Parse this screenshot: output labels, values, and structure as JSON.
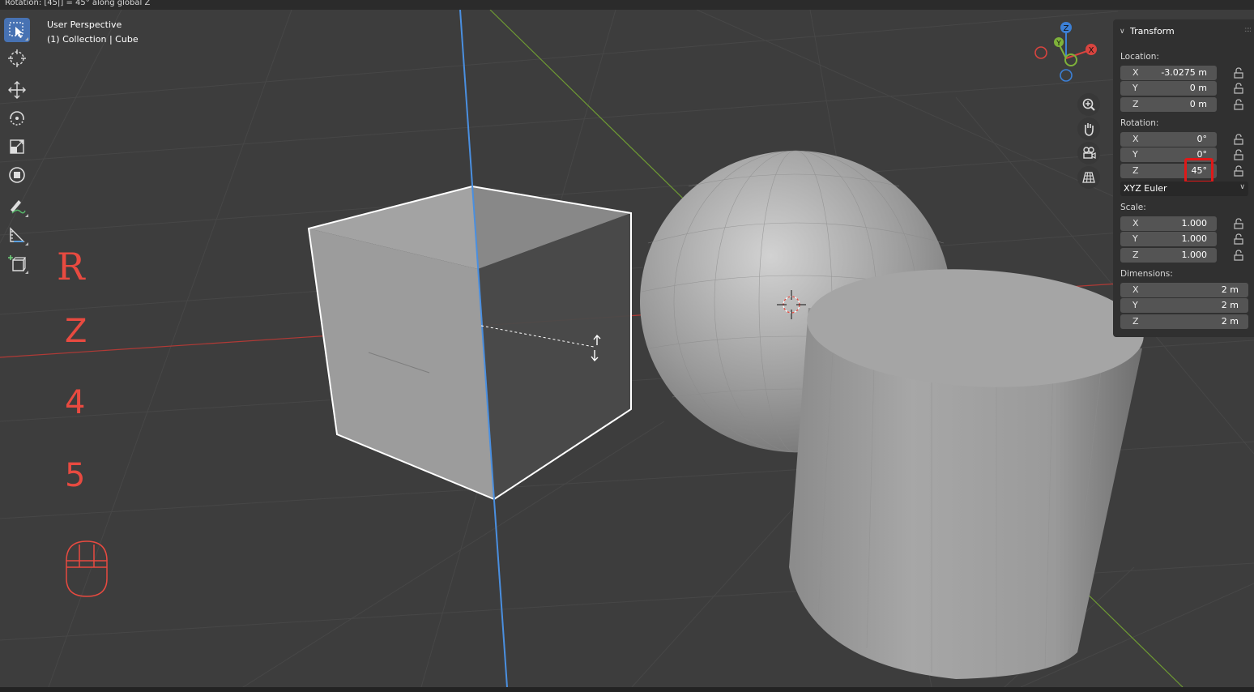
{
  "status_bar": {
    "text": "Rotation: [45|] = 45°  along global Z"
  },
  "viewport": {
    "view_name": "User Perspective",
    "collection_line": "(1) Collection | Cube"
  },
  "toolbar": {
    "tools": [
      "select-box",
      "cursor",
      "move",
      "rotate",
      "scale",
      "transform",
      "annotate",
      "measure",
      "add-cube"
    ]
  },
  "key_overlay": {
    "keys": [
      "R",
      "Z",
      "4",
      "5"
    ],
    "color": "#e84a40"
  },
  "gizmo": {
    "z": "Z",
    "y": "Y",
    "x": "X"
  },
  "transform_panel": {
    "title": "Transform",
    "location": {
      "label": "Location:",
      "x": {
        "axis": "X",
        "value": "-3.0275 m"
      },
      "y": {
        "axis": "Y",
        "value": "0 m"
      },
      "z": {
        "axis": "Z",
        "value": "0 m"
      }
    },
    "rotation": {
      "label": "Rotation:",
      "x": {
        "axis": "X",
        "value": "0°"
      },
      "y": {
        "axis": "Y",
        "value": "0°"
      },
      "z": {
        "axis": "Z",
        "value": "45°"
      },
      "mode": "XYZ Euler"
    },
    "scale": {
      "label": "Scale:",
      "x": {
        "axis": "X",
        "value": "1.000"
      },
      "y": {
        "axis": "Y",
        "value": "1.000"
      },
      "z": {
        "axis": "Z",
        "value": "1.000"
      }
    },
    "dimensions": {
      "label": "Dimensions:",
      "x": {
        "axis": "X",
        "value": "2 m"
      },
      "y": {
        "axis": "Y",
        "value": "2 m"
      },
      "z": {
        "axis": "Z",
        "value": "2 m"
      }
    }
  },
  "colors": {
    "accent": "#4772b3",
    "highlight": "#e01818",
    "x_axis": "#d9443f",
    "y_axis": "#7fb23a",
    "z_axis": "#3c80d6"
  }
}
